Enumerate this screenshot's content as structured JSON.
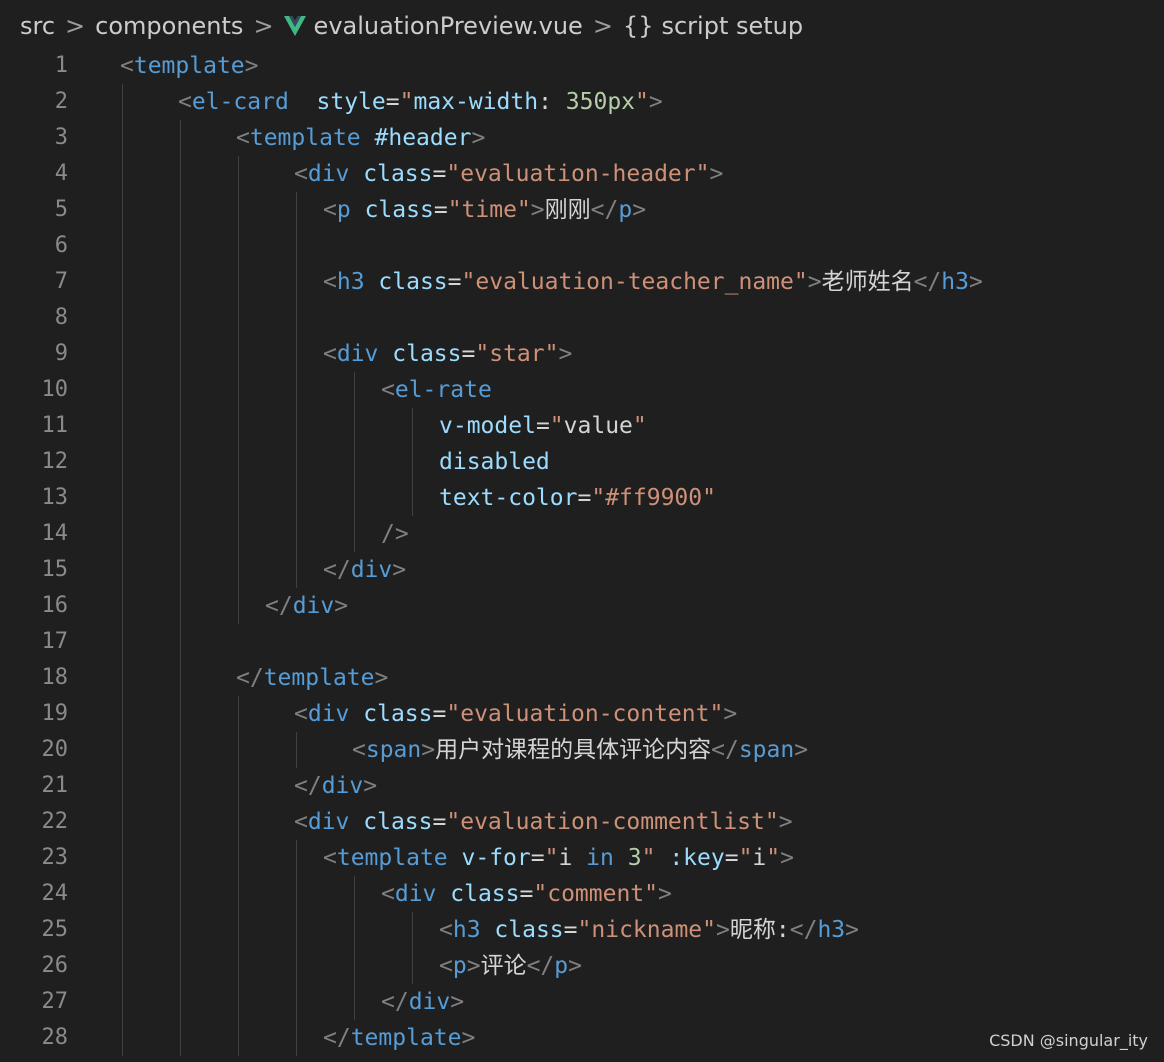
{
  "breadcrumb": {
    "items": [
      "src",
      "components",
      "evaluationPreview.vue",
      "script setup"
    ],
    "file_icon": "vue-icon",
    "symbol_icon": "braces-icon",
    "symbol_glyph": "{}",
    "separator_glyph": ">"
  },
  "colors": {
    "background": "#1f1f1f",
    "tag": "#569cd6",
    "attribute": "#9cdcfe",
    "string": "#ce9178",
    "punctuation": "#808080",
    "text": "#d4d4d4",
    "line_number": "#8a8a8a",
    "vue_green": "#41b883"
  },
  "code_lines": [
    {
      "n": "1",
      "indent": 0,
      "tokens": [
        [
          "p",
          "<"
        ],
        [
          "tag",
          "template"
        ],
        [
          "p",
          ">"
        ]
      ]
    },
    {
      "n": "2",
      "indent": 1,
      "tokens": [
        [
          "p",
          "<"
        ],
        [
          "tag",
          "el-card"
        ],
        [
          "plain",
          "  "
        ],
        [
          "attr",
          "style"
        ],
        [
          "plain",
          "="
        ],
        [
          "str",
          "\""
        ],
        [
          "attr",
          "max-width"
        ],
        [
          "plain",
          ": "
        ],
        [
          "num",
          "350px"
        ],
        [
          "str",
          "\""
        ],
        [
          "p",
          ">"
        ]
      ]
    },
    {
      "n": "3",
      "indent": 2,
      "tokens": [
        [
          "p",
          "<"
        ],
        [
          "tag",
          "template"
        ],
        [
          "plain",
          " "
        ],
        [
          "attr",
          "#header"
        ],
        [
          "p",
          ">"
        ]
      ]
    },
    {
      "n": "4",
      "indent": 3,
      "tokens": [
        [
          "p",
          "<"
        ],
        [
          "tag",
          "div"
        ],
        [
          "plain",
          " "
        ],
        [
          "attr",
          "class"
        ],
        [
          "plain",
          "="
        ],
        [
          "str",
          "\"evaluation-header\""
        ],
        [
          "p",
          ">"
        ]
      ]
    },
    {
      "n": "5",
      "indent": 3.5,
      "tokens": [
        [
          "p",
          "<"
        ],
        [
          "tag",
          "p"
        ],
        [
          "plain",
          " "
        ],
        [
          "attr",
          "class"
        ],
        [
          "plain",
          "="
        ],
        [
          "str",
          "\"time\""
        ],
        [
          "p",
          ">"
        ],
        [
          "plain",
          "刚刚"
        ],
        [
          "p",
          "</"
        ],
        [
          "tag",
          "p"
        ],
        [
          "p",
          ">"
        ]
      ]
    },
    {
      "n": "6",
      "indent": 3.5,
      "tokens": []
    },
    {
      "n": "7",
      "indent": 3.5,
      "tokens": [
        [
          "p",
          "<"
        ],
        [
          "tag",
          "h3"
        ],
        [
          "plain",
          " "
        ],
        [
          "attr",
          "class"
        ],
        [
          "plain",
          "="
        ],
        [
          "str",
          "\"evaluation-teacher_name\""
        ],
        [
          "p",
          ">"
        ],
        [
          "plain",
          "老师姓名"
        ],
        [
          "p",
          "</"
        ],
        [
          "tag",
          "h3"
        ],
        [
          "p",
          ">"
        ]
      ]
    },
    {
      "n": "8",
      "indent": 3.5,
      "tokens": []
    },
    {
      "n": "9",
      "indent": 3.5,
      "tokens": [
        [
          "p",
          "<"
        ],
        [
          "tag",
          "div"
        ],
        [
          "plain",
          " "
        ],
        [
          "attr",
          "class"
        ],
        [
          "plain",
          "="
        ],
        [
          "str",
          "\"star\""
        ],
        [
          "p",
          ">"
        ]
      ]
    },
    {
      "n": "10",
      "indent": 4.5,
      "tokens": [
        [
          "p",
          "<"
        ],
        [
          "tag",
          "el-rate"
        ]
      ]
    },
    {
      "n": "11",
      "indent": 5.5,
      "tokens": [
        [
          "attr",
          "v-model"
        ],
        [
          "plain",
          "="
        ],
        [
          "str",
          "\""
        ],
        [
          "plain",
          "value"
        ],
        [
          "str",
          "\""
        ]
      ]
    },
    {
      "n": "12",
      "indent": 5.5,
      "tokens": [
        [
          "attr",
          "disabled"
        ]
      ]
    },
    {
      "n": "13",
      "indent": 5.5,
      "tokens": [
        [
          "attr",
          "text-color"
        ],
        [
          "plain",
          "="
        ],
        [
          "str",
          "\"#ff9900\""
        ]
      ]
    },
    {
      "n": "14",
      "indent": 4.5,
      "tokens": [
        [
          "p",
          "/>"
        ]
      ]
    },
    {
      "n": "15",
      "indent": 3.5,
      "tokens": [
        [
          "p",
          "</"
        ],
        [
          "tag",
          "div"
        ],
        [
          "p",
          ">"
        ]
      ]
    },
    {
      "n": "16",
      "indent": 2.5,
      "tokens": [
        [
          "p",
          "</"
        ],
        [
          "tag",
          "div"
        ],
        [
          "p",
          ">"
        ]
      ]
    },
    {
      "n": "17",
      "indent": 2,
      "tokens": []
    },
    {
      "n": "18",
      "indent": 2,
      "tokens": [
        [
          "p",
          "</"
        ],
        [
          "tag",
          "template"
        ],
        [
          "p",
          ">"
        ]
      ]
    },
    {
      "n": "19",
      "indent": 3,
      "tokens": [
        [
          "p",
          "<"
        ],
        [
          "tag",
          "div"
        ],
        [
          "plain",
          " "
        ],
        [
          "attr",
          "class"
        ],
        [
          "plain",
          "="
        ],
        [
          "str",
          "\"evaluation-content\""
        ],
        [
          "p",
          ">"
        ]
      ]
    },
    {
      "n": "20",
      "indent": 4,
      "tokens": [
        [
          "p",
          "<"
        ],
        [
          "tag",
          "span"
        ],
        [
          "p",
          ">"
        ],
        [
          "plain",
          "用户对课程的具体评论内容"
        ],
        [
          "p",
          "</"
        ],
        [
          "tag",
          "span"
        ],
        [
          "p",
          ">"
        ]
      ]
    },
    {
      "n": "21",
      "indent": 3,
      "tokens": [
        [
          "p",
          "</"
        ],
        [
          "tag",
          "div"
        ],
        [
          "p",
          ">"
        ]
      ]
    },
    {
      "n": "22",
      "indent": 3,
      "tokens": [
        [
          "p",
          "<"
        ],
        [
          "tag",
          "div"
        ],
        [
          "plain",
          " "
        ],
        [
          "attr",
          "class"
        ],
        [
          "plain",
          "="
        ],
        [
          "str",
          "\"evaluation-commentlist\""
        ],
        [
          "p",
          ">"
        ]
      ]
    },
    {
      "n": "23",
      "indent": 3.5,
      "tokens": [
        [
          "p",
          "<"
        ],
        [
          "tag",
          "template"
        ],
        [
          "plain",
          " "
        ],
        [
          "attr",
          "v-for"
        ],
        [
          "plain",
          "="
        ],
        [
          "str",
          "\""
        ],
        [
          "plain",
          "i "
        ],
        [
          "tag",
          "in"
        ],
        [
          "plain",
          " "
        ],
        [
          "num",
          "3"
        ],
        [
          "str",
          "\""
        ],
        [
          "plain",
          " "
        ],
        [
          "attr",
          ":key"
        ],
        [
          "plain",
          "="
        ],
        [
          "str",
          "\""
        ],
        [
          "plain",
          "i"
        ],
        [
          "str",
          "\""
        ],
        [
          "p",
          ">"
        ]
      ]
    },
    {
      "n": "24",
      "indent": 4.5,
      "tokens": [
        [
          "p",
          "<"
        ],
        [
          "tag",
          "div"
        ],
        [
          "plain",
          " "
        ],
        [
          "attr",
          "class"
        ],
        [
          "plain",
          "="
        ],
        [
          "str",
          "\"comment\""
        ],
        [
          "p",
          ">"
        ]
      ]
    },
    {
      "n": "25",
      "indent": 5.5,
      "tokens": [
        [
          "p",
          "<"
        ],
        [
          "tag",
          "h3"
        ],
        [
          "plain",
          " "
        ],
        [
          "attr",
          "class"
        ],
        [
          "plain",
          "="
        ],
        [
          "str",
          "\"nickname\""
        ],
        [
          "p",
          ">"
        ],
        [
          "plain",
          "昵称:"
        ],
        [
          "p",
          "</"
        ],
        [
          "tag",
          "h3"
        ],
        [
          "p",
          ">"
        ]
      ]
    },
    {
      "n": "26",
      "indent": 5.5,
      "tokens": [
        [
          "p",
          "<"
        ],
        [
          "tag",
          "p"
        ],
        [
          "p",
          ">"
        ],
        [
          "plain",
          "评论"
        ],
        [
          "p",
          "</"
        ],
        [
          "tag",
          "p"
        ],
        [
          "p",
          ">"
        ]
      ]
    },
    {
      "n": "27",
      "indent": 4.5,
      "tokens": [
        [
          "p",
          "</"
        ],
        [
          "tag",
          "div"
        ],
        [
          "p",
          ">"
        ]
      ]
    },
    {
      "n": "28",
      "indent": 3.5,
      "tokens": [
        [
          "p",
          "</"
        ],
        [
          "tag",
          "template"
        ],
        [
          "p",
          ">"
        ]
      ]
    }
  ],
  "watermark": "CSDN @singular_ity"
}
